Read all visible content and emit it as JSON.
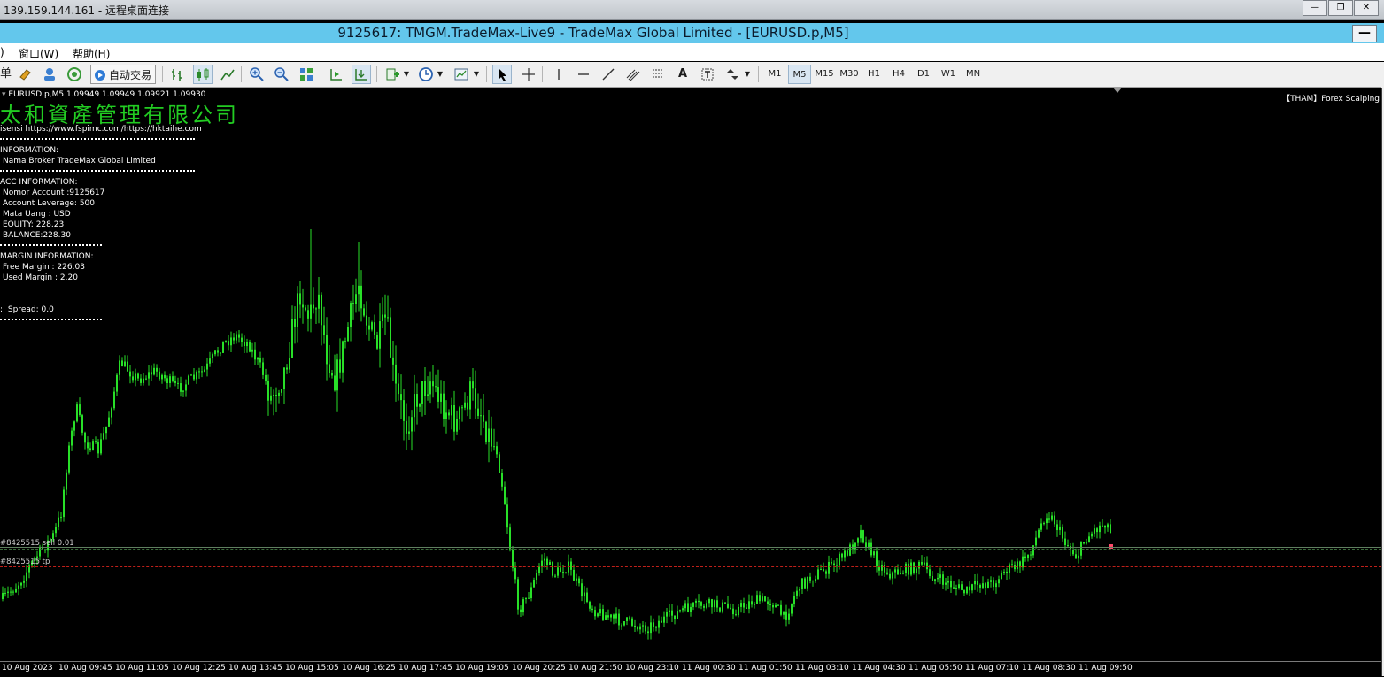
{
  "rdp": {
    "title": "139.159.144.161 - 远程桌面连接",
    "min_label": "—",
    "restore_label": "❐",
    "close_label": "✕"
  },
  "window": {
    "title": "9125617: TMGM.TradeMax-Live9 - TradeMax Global Limited - [EURUSD.p,M5]",
    "min_label": "—"
  },
  "menu": {
    "partial": ")",
    "window": "窗口(W)",
    "help": "帮助(H)"
  },
  "toolbar": {
    "new_order_partial": "单",
    "auto_trading": "自动交易",
    "text_tool": "A",
    "timeframes": [
      "M1",
      "M5",
      "M15",
      "M30",
      "H1",
      "H4",
      "D1",
      "W1",
      "MN"
    ],
    "active_timeframe": "M5"
  },
  "chart": {
    "header_arrow": "▾",
    "header": "EURUSD.p,M5  1.09949 1.09949 1.09921 1.09930",
    "indicator_label": "【THAM】Forex Scalping",
    "company": "太和資產管理有限公司",
    "license": "isensi https://www.fspimc.com/https://hktaihe.com",
    "info_title": "INFORMATION:",
    "broker": "Nama Broker TradeMax Global Limited",
    "acc_title": "ACC INFORMATION:",
    "account": "Nomor Account :9125617",
    "leverage": "Account Leverage: 500",
    "currency": "Mata Uang : USD",
    "equity": "EQUITY: 228.23",
    "balance": "BALANCE:228.30",
    "margin_title": "MARGIN INFORMATION:",
    "free_margin": "Free Margin : 226.03",
    "used_margin": "Used Margin : 2.20",
    "spread": ":: Spread: 0.0",
    "order_sell": "#8425515 sell 0.01",
    "order_tp": "#8425515 tp",
    "time_labels": [
      "10 Aug 2023",
      "10 Aug 09:45",
      "10 Aug 11:05",
      "10 Aug 12:25",
      "10 Aug 13:45",
      "10 Aug 15:05",
      "10 Aug 16:25",
      "10 Aug 17:45",
      "10 Aug 19:05",
      "10 Aug 20:25",
      "10 Aug 21:50",
      "10 Aug 23:10",
      "11 Aug 00:30",
      "11 Aug 01:50",
      "11 Aug 03:10",
      "11 Aug 04:30",
      "11 Aug 05:50",
      "11 Aug 07:10",
      "11 Aug 08:30",
      "11 Aug 09:50"
    ],
    "candle_color": "#28e028",
    "current_bar_color": "#ff4a6a"
  }
}
